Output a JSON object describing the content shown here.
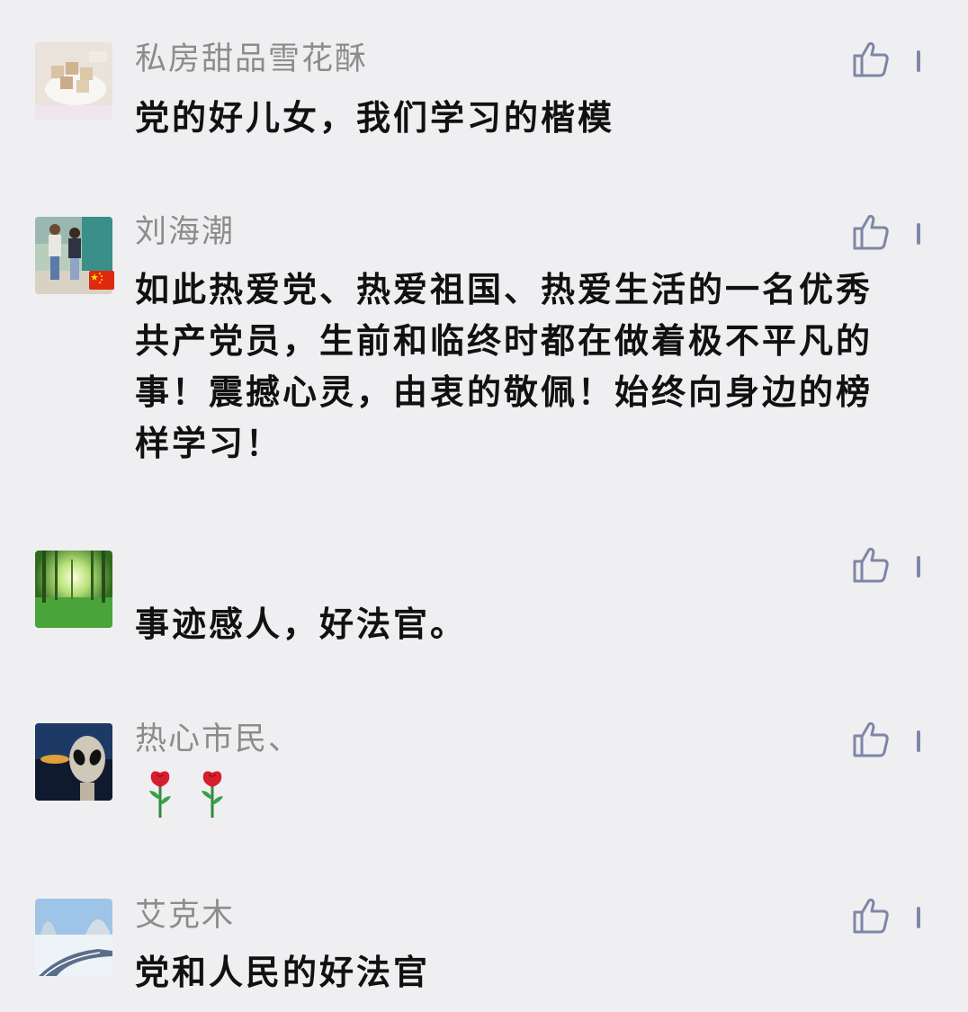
{
  "comments": [
    {
      "name": "私房甜品雪花酥",
      "text": "党的好儿女，我们学习的楷模",
      "avatar_icon": "dessert-photo-avatar"
    },
    {
      "name": "刘海潮",
      "text": "如此热爱党、热爱祖国、热爱生活的一名优秀共产党员，生前和临终时都在做着极不平凡的事！震撼心灵，由衷的敬佩！始终向身边的榜样学习！",
      "avatar_icon": "couple-photo-avatar",
      "badge_icon": "china-flag-icon"
    },
    {
      "name": "",
      "text": "事迹感人，好法官。",
      "avatar_icon": "forest-photo-avatar"
    },
    {
      "name": "热心市民、",
      "text": "",
      "emoji": [
        "rose-emoji",
        "rose-emoji"
      ],
      "avatar_icon": "alien-photo-avatar"
    },
    {
      "name": "艾克木",
      "text": "党和人民的好法官",
      "avatar_icon": "snowy-road-photo-avatar"
    }
  ],
  "icons": {
    "like": "thumbs-up-icon",
    "more": "more-icon"
  },
  "colors": {
    "background": "#efeff1",
    "name": "#8c8c8c",
    "text": "#111111",
    "icon": "#7f86a6",
    "rose": "#d81e2c"
  }
}
